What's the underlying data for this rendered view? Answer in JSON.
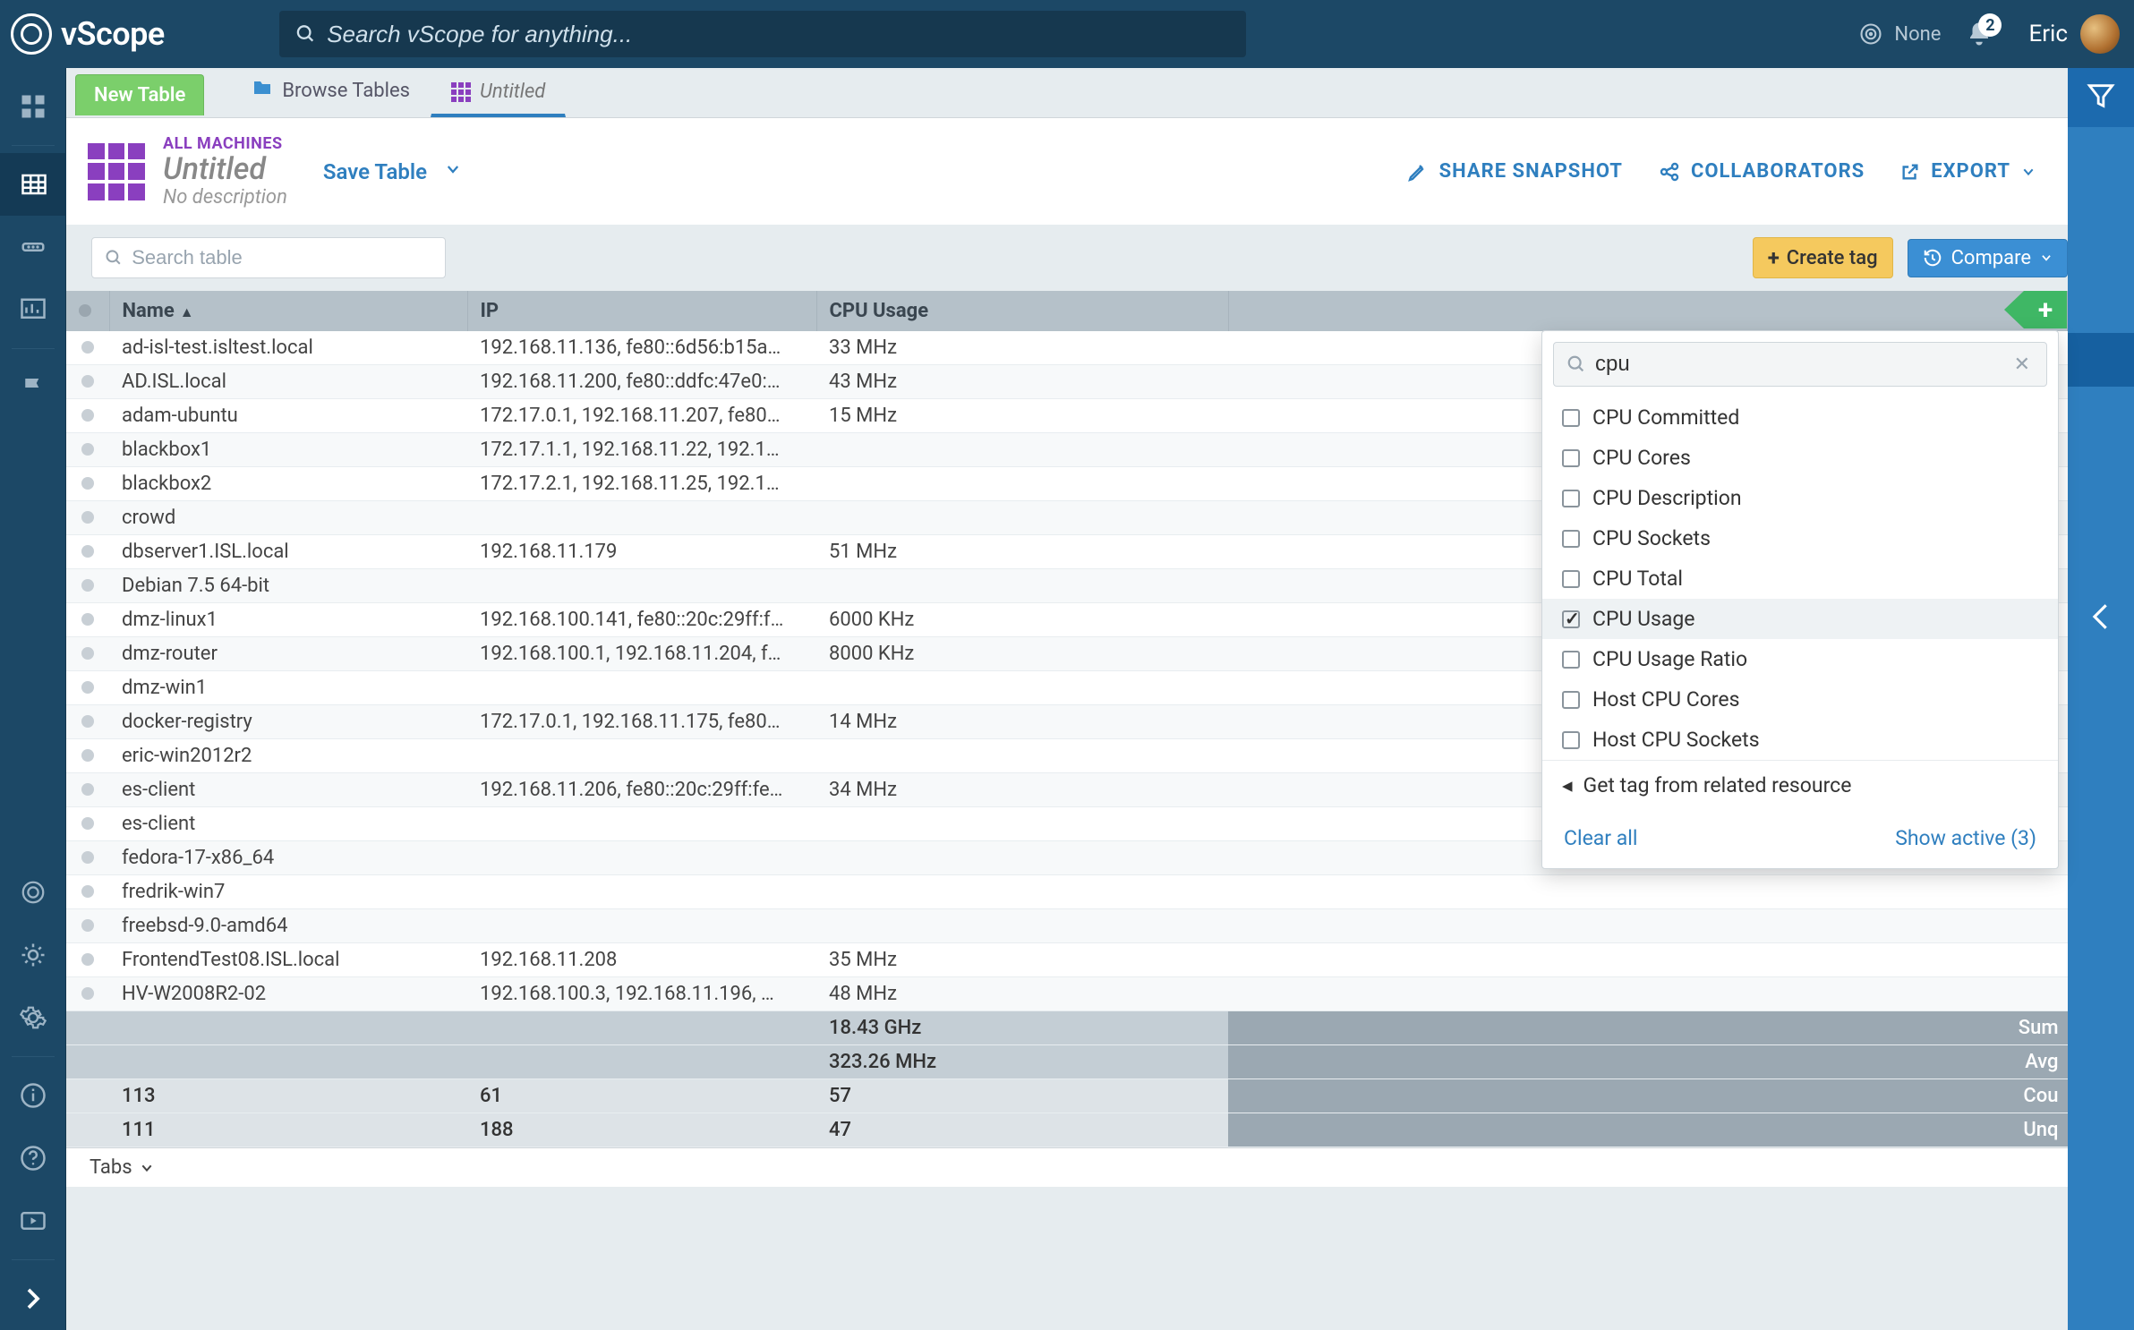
{
  "topbar": {
    "logo_text": "vScope",
    "search_placeholder": "Search vScope for anything...",
    "none_label": "None",
    "notif_count": "2",
    "user_name": "Eric"
  },
  "tabstrip": {
    "new_table": "New Table",
    "browse": "Browse Tables",
    "untitled": "Untitled"
  },
  "header": {
    "crumb": "ALL MACHINES",
    "title": "Untitled",
    "desc": "No description",
    "save": "Save Table",
    "share": "SHARE SNAPSHOT",
    "collab": "COLLABORATORS",
    "export": "EXPORT"
  },
  "toolbar": {
    "search_placeholder": "Search table",
    "create_tag": "Create tag",
    "compare": "Compare"
  },
  "columns": {
    "name": "Name",
    "ip": "IP",
    "cpu": "CPU Usage"
  },
  "rows": [
    {
      "name": "ad-isl-test.isltest.local",
      "ip": "192.168.11.136, fe80::6d56:b15a…",
      "cpu": "33 MHz"
    },
    {
      "name": "AD.ISL.local",
      "ip": "192.168.11.200, fe80::ddfc:47e0:…",
      "cpu": "43 MHz"
    },
    {
      "name": "adam-ubuntu",
      "ip": "172.17.0.1, 192.168.11.207, fe80…",
      "cpu": "15 MHz"
    },
    {
      "name": "blackbox1",
      "ip": "172.17.1.1, 192.168.11.22, 192.1…",
      "cpu": ""
    },
    {
      "name": "blackbox2",
      "ip": "172.17.2.1, 192.168.11.25, 192.1…",
      "cpu": ""
    },
    {
      "name": "crowd",
      "ip": "",
      "cpu": ""
    },
    {
      "name": "dbserver1.ISL.local",
      "ip": "192.168.11.179",
      "cpu": "51 MHz"
    },
    {
      "name": "Debian 7.5 64-bit",
      "ip": "",
      "cpu": ""
    },
    {
      "name": "dmz-linux1",
      "ip": "192.168.100.141, fe80::20c:29ff:f…",
      "cpu": "6000 KHz"
    },
    {
      "name": "dmz-router",
      "ip": "192.168.100.1, 192.168.11.204, f…",
      "cpu": "8000 KHz"
    },
    {
      "name": "dmz-win1",
      "ip": "",
      "cpu": ""
    },
    {
      "name": "docker-registry",
      "ip": "172.17.0.1, 192.168.11.175, fe80…",
      "cpu": "14 MHz"
    },
    {
      "name": "eric-win2012r2",
      "ip": "",
      "cpu": ""
    },
    {
      "name": "es-client",
      "ip": "192.168.11.206, fe80::20c:29ff:fe…",
      "cpu": "34 MHz"
    },
    {
      "name": "es-client",
      "ip": "",
      "cpu": ""
    },
    {
      "name": "fedora-17-x86_64",
      "ip": "",
      "cpu": ""
    },
    {
      "name": "fredrik-win7",
      "ip": "",
      "cpu": ""
    },
    {
      "name": "freebsd-9.0-amd64",
      "ip": "",
      "cpu": ""
    },
    {
      "name": "FrontendTest08.ISL.local",
      "ip": "192.168.11.208",
      "cpu": "35 MHz"
    },
    {
      "name": "HV-W2008R2-02",
      "ip": "192.168.100.3, 192.168.11.196, …",
      "cpu": "48 MHz"
    }
  ],
  "summary": {
    "sum_cpu": "18.43 GHz",
    "avg_cpu": "323.26 MHz",
    "cou": {
      "name": "113",
      "ip": "61",
      "cpu": "57"
    },
    "unq": {
      "name": "111",
      "ip": "188",
      "cpu": "47"
    },
    "labels": {
      "sum": "Sum",
      "avg": "Avg",
      "cou": "Cou",
      "unq": "Unq"
    }
  },
  "dropdown": {
    "query": "cpu",
    "items": [
      {
        "label": "CPU Committed",
        "checked": false
      },
      {
        "label": "CPU Cores",
        "checked": false
      },
      {
        "label": "CPU Description",
        "checked": false
      },
      {
        "label": "CPU Sockets",
        "checked": false
      },
      {
        "label": "CPU Total",
        "checked": false
      },
      {
        "label": "CPU Usage",
        "checked": true
      },
      {
        "label": "CPU Usage Ratio",
        "checked": false
      },
      {
        "label": "Host CPU Cores",
        "checked": false
      },
      {
        "label": "Host CPU Sockets",
        "checked": false
      }
    ],
    "related": "Get tag from related resource",
    "clear": "Clear all",
    "show_active": "Show active (3)"
  },
  "bottom": {
    "tabs": "Tabs"
  }
}
